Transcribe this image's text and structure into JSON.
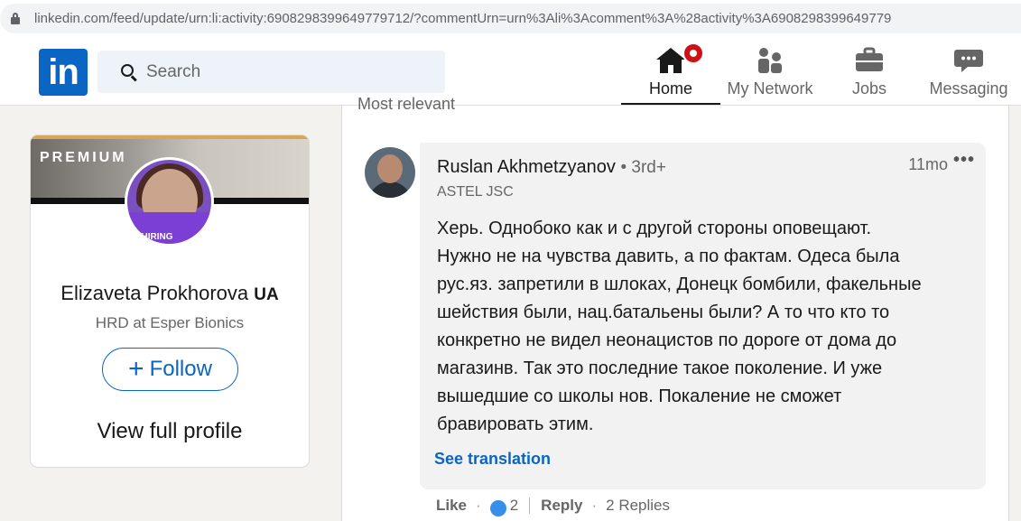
{
  "browser": {
    "url": "linkedin.com/feed/update/urn:li:activity:6908298399649779712/?commentUrn=urn%3Ali%3Acomment%3A%28activity%3A6908298399649779"
  },
  "nav": {
    "logo_text": "in",
    "search_placeholder": "Search",
    "items": [
      {
        "label": "Home",
        "icon": "home-icon",
        "active": true
      },
      {
        "label": "My Network",
        "icon": "network-icon",
        "active": false
      },
      {
        "label": "Jobs",
        "icon": "briefcase-icon",
        "active": false
      },
      {
        "label": "Messaging",
        "icon": "chat-icon",
        "active": false
      }
    ]
  },
  "profile": {
    "banner_label": "PREMIUM",
    "avatar_tag": "#HIRING",
    "name": "Elizaveta Prokhorova",
    "name_flag": "UA",
    "headline": "HRD at Esper Bionics",
    "follow_label": "Follow",
    "view_profile_label": "View full profile"
  },
  "feed": {
    "sort_label": "Most relevant",
    "comment": {
      "author": "Ruslan Akhmetzyanov",
      "degree": "• 3rd+",
      "company": "ASTEL JSC",
      "time": "11mo",
      "more": "•••",
      "lines": [
        "Херь. Однобоко как и с другой стороны оповещают.",
        "Нужно не на чувства давить, а по фактам. Одеса была",
        "рус.яз. запретили в шлоках, Донецк бомбили, факельные",
        "шействия были, нац.батальены были? А то что кто то",
        "конкретно не видел неонацистов по дороге от дома до",
        "магазинв. Так это последние такое поколение. И уже",
        "вышедшие со школы нов. Покаление не сможет",
        "бравировать этим."
      ],
      "see_translation": "See translation",
      "like_label": "Like",
      "reaction_count": "2",
      "reply_label": "Reply",
      "replies_label": "2 Replies"
    }
  },
  "colors": {
    "brand": "#0a66c2",
    "notification": "#cc1016"
  }
}
